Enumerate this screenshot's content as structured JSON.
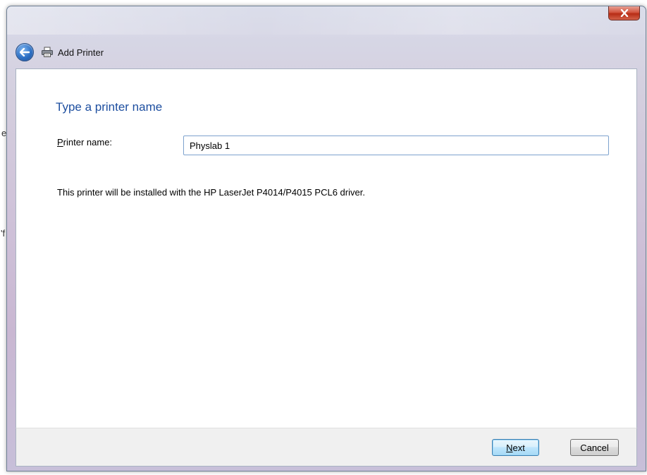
{
  "window": {
    "title": "Add Printer",
    "close_glyph": "X"
  },
  "icons": {
    "back": "back-arrow-icon",
    "printer": "printer-icon",
    "close": "close-icon"
  },
  "page": {
    "heading": "Type a printer name",
    "printer_name_label_accel": "P",
    "printer_name_label_rest": "rinter name:",
    "printer_name_value": "Physlab 1",
    "driver_note": "This printer will be installed with the HP LaserJet P4014/P4015 PCL6 driver."
  },
  "footer": {
    "next_accel": "N",
    "next_rest": "ext",
    "cancel_label": "Cancel"
  },
  "background_fragments": [
    "e",
    "'f"
  ],
  "colors": {
    "heading": "#1e4fa0",
    "close_button": "#c8402a",
    "footer_bg": "#f0f0f0"
  }
}
